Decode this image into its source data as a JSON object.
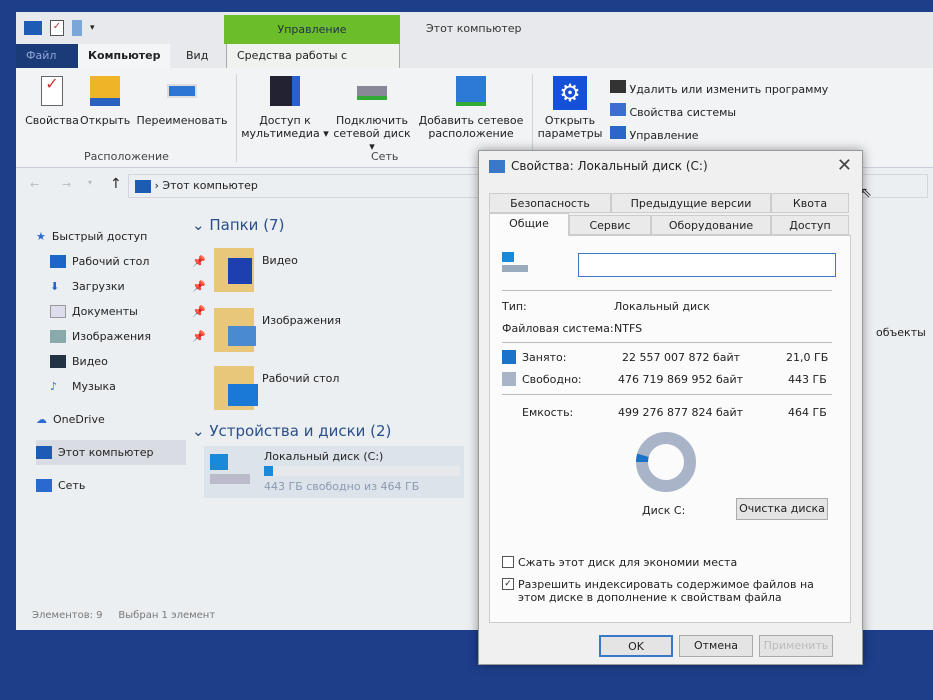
{
  "explorer": {
    "title": "Этот компьютер",
    "context_tab_group": "Управление",
    "tabs": [
      "Файл",
      "Компьютер",
      "Вид",
      "Средства работы с дисками"
    ],
    "ribbon": {
      "location": {
        "buttons": [
          "Свойства",
          "Открыть",
          "Переименовать"
        ],
        "label": "Расположение"
      },
      "network": {
        "buttons": [
          "Доступ к мультимедиа",
          "Подключить сетевой диск",
          "Добавить сетевое расположение"
        ],
        "label": "Сеть"
      },
      "system": {
        "open_settings": "Открыть параметры",
        "links": [
          "Удалить или изменить программу",
          "Свойства системы",
          "Управление"
        ]
      }
    },
    "address": "Этот компьютер",
    "sidebar": {
      "quick_access": "Быстрый доступ",
      "items": [
        "Рабочий стол",
        "Загрузки",
        "Документы",
        "Изображения",
        "Видео",
        "Музыка"
      ],
      "onedrive": "OneDrive",
      "this_pc": "Этот компьютер",
      "network": "Сеть"
    },
    "folders_header": "Папки (7)",
    "folders": [
      "Видео",
      "Изображения",
      "Рабочий стол"
    ],
    "devices_header": "Устройства и диски (2)",
    "drive": {
      "name": "Локальный диск (C:)",
      "free_text": "443 ГБ свободно из 464 ГБ",
      "used_fraction": 0.045
    },
    "partial_text": "объекты",
    "status": {
      "items": "Элементов: 9",
      "selected": "Выбран 1 элемент"
    }
  },
  "dialog": {
    "title": "Свойства: Локальный диск (C:)",
    "tabs_back": [
      "Безопасность",
      "Предыдущие версии",
      "Квота"
    ],
    "tabs_front": [
      "Общие",
      "Сервис",
      "Оборудование",
      "Доступ"
    ],
    "label_value": "",
    "type_label": "Тип:",
    "type_value": "Локальный диск",
    "fs_label": "Файловая система:",
    "fs_value": "NTFS",
    "used": {
      "label": "Занято:",
      "bytes": "22 557 007 872 байт",
      "size": "21,0 ГБ"
    },
    "free": {
      "label": "Свободно:",
      "bytes": "476 719 869 952 байт",
      "size": "443 ГБ"
    },
    "capacity": {
      "label": "Емкость:",
      "bytes": "499 276 877 824 байт",
      "size": "464 ГБ"
    },
    "disk_label": "Диск C:",
    "cleanup": "Очистка диска",
    "compress": "Сжать этот диск для экономии места",
    "index": "Разрешить индексировать содержимое файлов на этом диске в дополнение к свойствам файла",
    "ok": "OK",
    "cancel": "Отмена",
    "apply": "Применить",
    "colors": {
      "used": "#1a73c8",
      "free": "#a9b4c8"
    }
  }
}
